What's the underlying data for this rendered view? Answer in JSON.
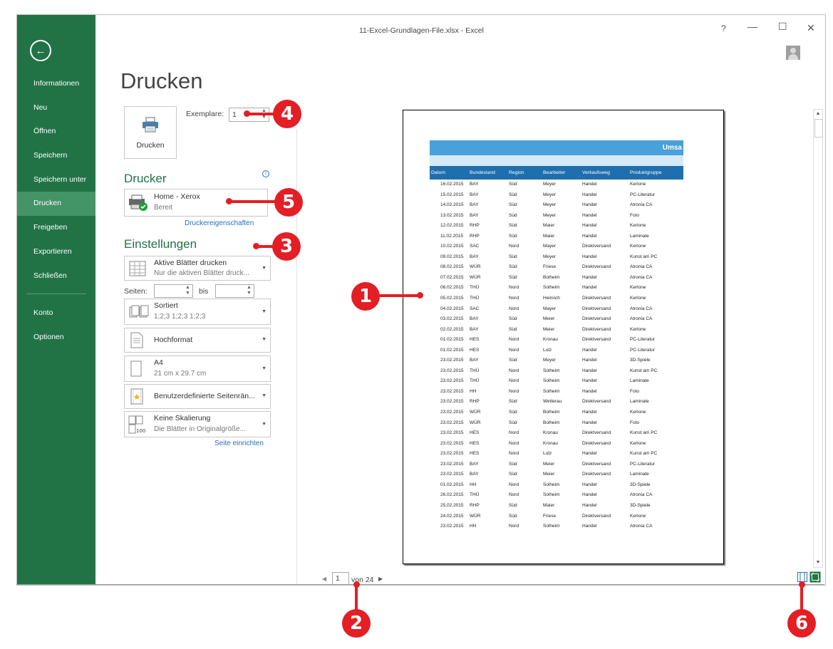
{
  "window": {
    "title": "11-Excel-Grundlagen-File.xlsx - Excel",
    "help": "?",
    "minimize": "—",
    "maximize": "☐",
    "close": "✕"
  },
  "sidebar": {
    "back_icon": "arrow-left-circle",
    "items": [
      {
        "label": "Informationen"
      },
      {
        "label": "Neu"
      },
      {
        "label": "Öffnen"
      },
      {
        "label": "Speichern"
      },
      {
        "label": "Speichern unter"
      },
      {
        "label": "Drucken",
        "active": true
      },
      {
        "label": "Freigeben"
      },
      {
        "label": "Exportieren"
      },
      {
        "label": "Schließen"
      }
    ],
    "bottom_items": [
      {
        "label": "Konto"
      },
      {
        "label": "Optionen"
      }
    ],
    "bg_color": "#217346",
    "active_color": "#439467"
  },
  "print_panel": {
    "title": "Drucken",
    "print_button": "Drucken",
    "copies_label": "Exemplare:",
    "copies_value": "1",
    "printer_heading": "Drucker",
    "printer_name": "Home - Xerox",
    "printer_status": "Bereit",
    "printer_properties": "Druckereigenschaften",
    "settings_heading": "Einstellungen",
    "settings": [
      {
        "line1": "Aktive Blätter drucken",
        "line2": "Nur die aktiven Blätter druck..."
      },
      {
        "line1": "Sortiert",
        "line2": "1;2;3   1;2;3   1;2;3"
      },
      {
        "line1": "Hochformat",
        "line2": ""
      },
      {
        "line1": "A4",
        "line2": "21  cm x 29.7  cm"
      },
      {
        "line1": "Benutzerdefinierte Seitenrän...",
        "line2": ""
      },
      {
        "line1": "Keine Skalierung",
        "line2": "Die Blätter in Originalgröße..."
      }
    ],
    "pages_label": "Seiten:",
    "pages_to": "bis",
    "page_setup_link": "Seite einrichten"
  },
  "preview": {
    "title": "Umsa",
    "headers": [
      "Datum",
      "Bundesland",
      "Region",
      "Bearbeiter",
      "Verkaufsweg",
      "Produktgruppe"
    ],
    "rows": [
      [
        "16.02.2015",
        "BAY",
        "Süd",
        "Meyer",
        "Handel",
        "Kerlone"
      ],
      [
        "15.02.2015",
        "BAY",
        "Süd",
        "Meyer",
        "Handel",
        "PC-Literatur"
      ],
      [
        "14.02.2015",
        "BAY",
        "Süd",
        "Meyer",
        "Handel",
        "Atronia CA"
      ],
      [
        "13.02.2015",
        "BAY",
        "Süd",
        "Meyer",
        "Handel",
        "Foto"
      ],
      [
        "12.02.2015",
        "RHP",
        "Süd",
        "Maier",
        "Handel",
        "Kerlone"
      ],
      [
        "11.02.2015",
        "RHP",
        "Süd",
        "Maier",
        "Handel",
        "Laminate"
      ],
      [
        "10.02.2015",
        "SAC",
        "Nord",
        "Mayer",
        "Direktversand",
        "Kerlone"
      ],
      [
        "09.02.2015",
        "BAY",
        "Süd",
        "Meyer",
        "Handel",
        "Kunst am PC"
      ],
      [
        "08.02.2015",
        "WÜR",
        "Süd",
        "Friese",
        "Direktversand",
        "Atronia CA"
      ],
      [
        "07.02.2015",
        "WÜR",
        "Süd",
        "Bolheim",
        "Handel",
        "Atronia CA"
      ],
      [
        "06.02.2015",
        "THÜ",
        "Nord",
        "Solheim",
        "Handel",
        "Kerlone"
      ],
      [
        "05.02.2015",
        "THÜ",
        "Nord",
        "Heinrich",
        "Direktversand",
        "Kerlone"
      ],
      [
        "04.02.2015",
        "SAC",
        "Nord",
        "Mayer",
        "Direktversand",
        "Atronia CA"
      ],
      [
        "03.02.2015",
        "BAY",
        "Süd",
        "Meier",
        "Direktversand",
        "Atronia CA"
      ],
      [
        "02.02.2015",
        "BAY",
        "Süd",
        "Meier",
        "Direktversand",
        "Kerlone"
      ],
      [
        "01.02.2015",
        "HES",
        "Nord",
        "Kronau",
        "Direktversand",
        "PC-Literatur"
      ],
      [
        "01.02.2015",
        "HES",
        "Nord",
        "Lutz",
        "Handel",
        "PC-Literatur"
      ],
      [
        "23.02.2015",
        "BAY",
        "Süd",
        "Meyer",
        "Handel",
        "3D-Spiele"
      ],
      [
        "23.02.2015",
        "THÜ",
        "Nord",
        "Solheim",
        "Handel",
        "Kunst am PC"
      ],
      [
        "23.02.2015",
        "THÜ",
        "Nord",
        "Solheim",
        "Handel",
        "Laminate"
      ],
      [
        "23.02.2015",
        "HH",
        "Nord",
        "Solheim",
        "Handel",
        "Foto"
      ],
      [
        "23.02.2015",
        "RHP",
        "Süd",
        "Wetterau",
        "Direktversand",
        "Laminate"
      ],
      [
        "23.02.2015",
        "WÜR",
        "Süd",
        "Bolheim",
        "Handel",
        "Kerlone"
      ],
      [
        "23.02.2015",
        "WÜR",
        "Süd",
        "Bolheim",
        "Handel",
        "Foto"
      ],
      [
        "23.02.2015",
        "HES",
        "Nord",
        "Kronau",
        "Direktversand",
        "Kunst am PC"
      ],
      [
        "23.02.2015",
        "HES",
        "Nord",
        "Kronau",
        "Direktversand",
        "Kerlone"
      ],
      [
        "23.02.2015",
        "HES",
        "Nord",
        "Lutz",
        "Handel",
        "Kunst am PC"
      ],
      [
        "23.02.2015",
        "BAY",
        "Süd",
        "Meier",
        "Direktversand",
        "PC-Literatur"
      ],
      [
        "23.02.2015",
        "BAY",
        "Süd",
        "Meier",
        "Direktversand",
        "Laminate"
      ],
      [
        "01.02.2015",
        "HH",
        "Nord",
        "Solheim",
        "Handel",
        "3D-Spiele"
      ],
      [
        "26.02.2015",
        "THÜ",
        "Nord",
        "Solheim",
        "Handel",
        "Atronia CA"
      ],
      [
        "25.02.2015",
        "RHP",
        "Süd",
        "Maier",
        "Handel",
        "3D-Spiele"
      ],
      [
        "24.02.2015",
        "WÜR",
        "Süd",
        "Friese",
        "Direktversand",
        "Kerlone"
      ],
      [
        "23.02.2015",
        "HH",
        "Nord",
        "Solheim",
        "Handel",
        "Atronia CA"
      ]
    ]
  },
  "page_nav": {
    "current": "1",
    "total_label": "von 24"
  },
  "callouts": [
    "1",
    "2",
    "3",
    "4",
    "5",
    "6"
  ],
  "colors": {
    "accent_red": "#e31e24",
    "excel_green": "#217346",
    "table_header": "#1f6fae",
    "table_title": "#4aa0d8"
  }
}
